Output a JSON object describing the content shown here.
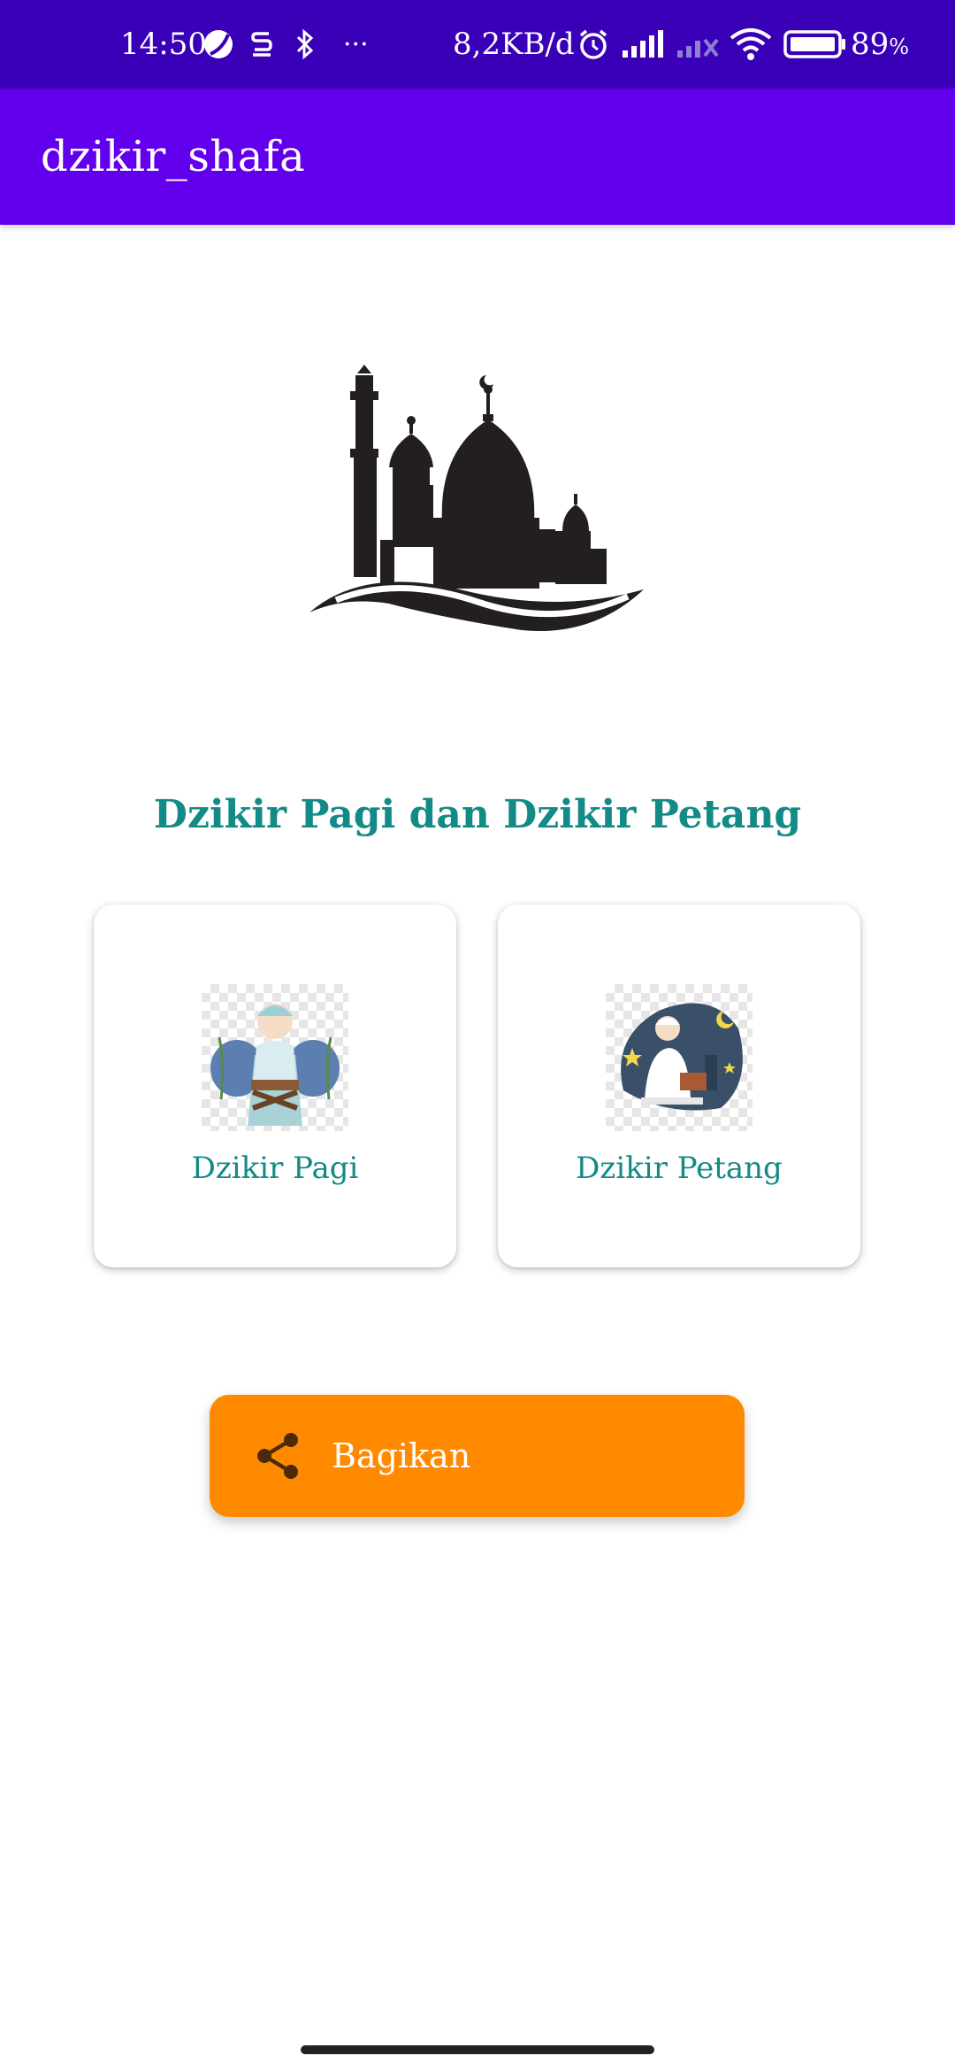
{
  "status_bar": {
    "time": "14:50",
    "more": "···",
    "network_speed": "8,2KB/d",
    "battery": "89",
    "battery_unit": "%",
    "background_color": "#3a00b8",
    "icons": [
      "moon-icon",
      "s-app-icon",
      "bluetooth-icon",
      "alarm-icon",
      "signal-icon",
      "signal-off-icon",
      "wifi-icon",
      "battery-icon"
    ]
  },
  "app_bar": {
    "title": "dzikir_shafa",
    "background_color": "#6200ee"
  },
  "main": {
    "logo_icon": "mosque-icon",
    "headline": "Dzikir Pagi dan Dzikir Petang",
    "accent_color": "#128a86",
    "cards": [
      {
        "label": "Dzikir Pagi",
        "icon": "morning-dzikir-illustration"
      },
      {
        "label": "Dzikir Petang",
        "icon": "evening-dzikir-illustration"
      }
    ],
    "share_button": {
      "label": "Bagikan",
      "icon": "share-icon",
      "color": "#ff8a00"
    }
  }
}
